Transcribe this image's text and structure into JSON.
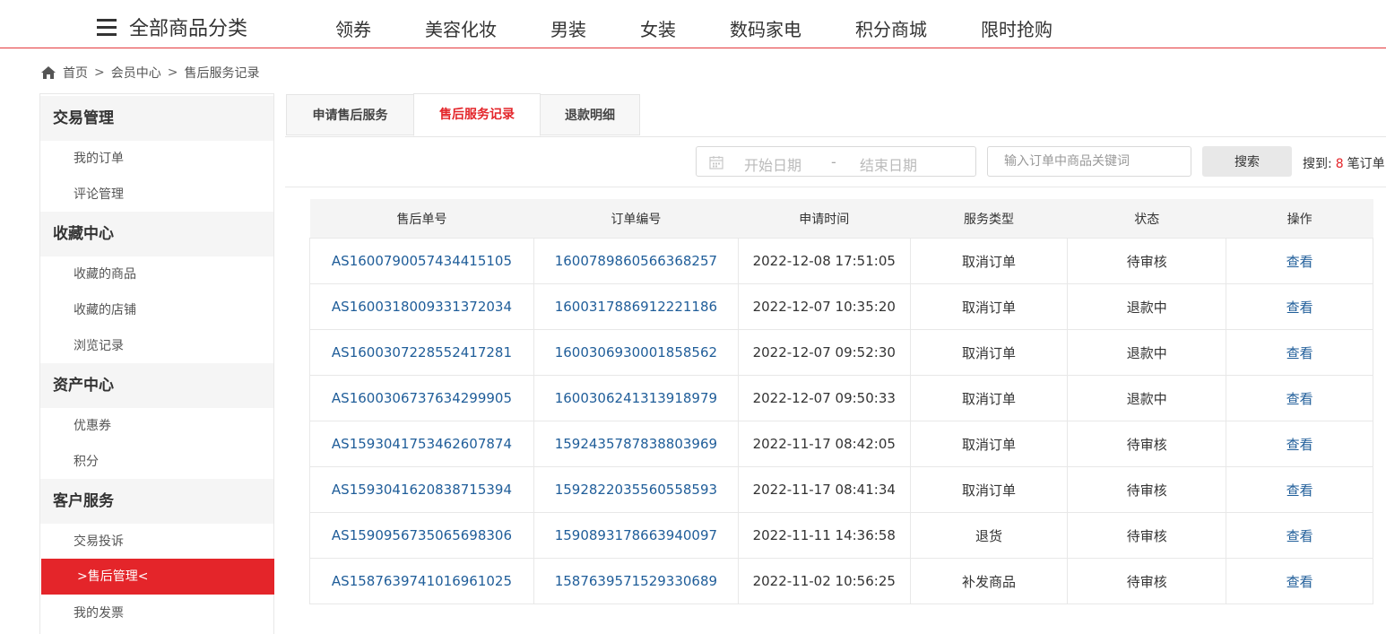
{
  "topnav": {
    "category_label": "全部商品分类",
    "items": [
      "领券",
      "美容化妆",
      "男装",
      "女装",
      "数码家电",
      "积分商城",
      "限时抢购"
    ]
  },
  "breadcrumb": [
    "首页",
    "会员中心",
    "售后服务记录"
  ],
  "sidebar": {
    "sections": [
      {
        "title": "交易管理",
        "items": [
          "我的订单",
          "评论管理"
        ]
      },
      {
        "title": "收藏中心",
        "items": [
          "收藏的商品",
          "收藏的店铺",
          "浏览记录"
        ]
      },
      {
        "title": "资产中心",
        "items": [
          "优惠券",
          "积分"
        ]
      },
      {
        "title": "客户服务",
        "items": [
          "交易投诉",
          ">售后管理<",
          "我的发票"
        ]
      }
    ],
    "active_item": ">售后管理<"
  },
  "tabs": [
    "申请售后服务",
    "售后服务记录",
    "退款明细"
  ],
  "active_tab": "售后服务记录",
  "search": {
    "start_date_placeholder": "开始日期",
    "separator": "-",
    "end_date_placeholder": "结束日期",
    "keyword_placeholder": "输入订单中商品关键词",
    "button_label": "搜索",
    "result_prefix": "搜到:",
    "result_count": "8",
    "result_suffix": "笔订单"
  },
  "table": {
    "headers": [
      "售后单号",
      "订单编号",
      "申请时间",
      "服务类型",
      "状态",
      "操作"
    ],
    "rows": [
      [
        "AS1600790057434415105",
        "1600789860566368257",
        "2022-12-08 17:51:05",
        "取消订单",
        "待审核",
        "查看"
      ],
      [
        "AS1600318009331372034",
        "1600317886912221186",
        "2022-12-07 10:35:20",
        "取消订单",
        "退款中",
        "查看"
      ],
      [
        "AS1600307228552417281",
        "1600306930001858562",
        "2022-12-07 09:52:30",
        "取消订单",
        "退款中",
        "查看"
      ],
      [
        "AS1600306737634299905",
        "1600306241313918979",
        "2022-12-07 09:50:33",
        "取消订单",
        "退款中",
        "查看"
      ],
      [
        "AS1593041753462607874",
        "1592435787838803969",
        "2022-11-17 08:42:05",
        "取消订单",
        "待审核",
        "查看"
      ],
      [
        "AS1593041620838715394",
        "1592822035560558593",
        "2022-11-17 08:41:34",
        "取消订单",
        "待审核",
        "查看"
      ],
      [
        "AS1590956735065698306",
        "1590893178663940097",
        "2022-11-11 14:36:58",
        "退货",
        "待审核",
        "查看"
      ],
      [
        "AS1587639741016961025",
        "1587639571529330689",
        "2022-11-02 10:56:25",
        "补发商品",
        "待审核",
        "查看"
      ]
    ]
  },
  "colors": {
    "accent": "#e4252a",
    "link": "#1f5d99",
    "header_bg": "#f4f4f4"
  }
}
